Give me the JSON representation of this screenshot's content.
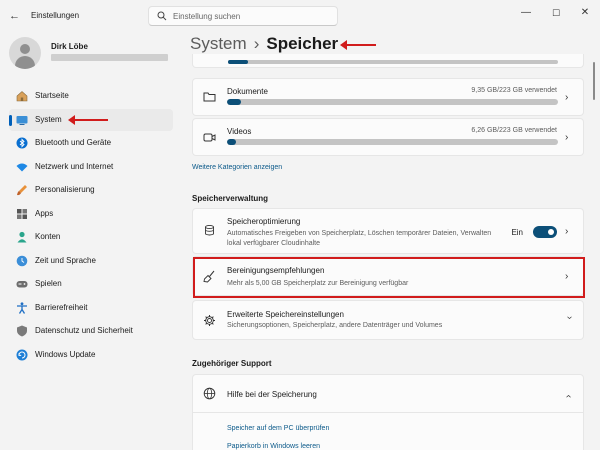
{
  "window": {
    "app_title": "Einstellungen",
    "controls": {
      "minimize": "—",
      "maximize": "☐",
      "close": "✕"
    }
  },
  "search": {
    "placeholder": "Einstellung suchen"
  },
  "profile": {
    "name": "Dirk Löbe"
  },
  "sidebar": {
    "items": [
      {
        "label": "Startseite",
        "icon": "home-icon"
      },
      {
        "label": "System",
        "icon": "system-display-icon",
        "active": true
      },
      {
        "label": "Bluetooth und Geräte",
        "icon": "bluetooth-icon"
      },
      {
        "label": "Netzwerk und Internet",
        "icon": "wifi-icon"
      },
      {
        "label": "Personalisierung",
        "icon": "paintbrush-icon"
      },
      {
        "label": "Apps",
        "icon": "apps-icon"
      },
      {
        "label": "Konten",
        "icon": "account-icon"
      },
      {
        "label": "Zeit und Sprache",
        "icon": "globe-clock-icon"
      },
      {
        "label": "Spielen",
        "icon": "gamepad-icon"
      },
      {
        "label": "Barrierefreiheit",
        "icon": "accessibility-icon"
      },
      {
        "label": "Datenschutz und Sicherheit",
        "icon": "shield-icon"
      },
      {
        "label": "Windows Update",
        "icon": "update-icon"
      }
    ]
  },
  "breadcrumb": {
    "parent": "System",
    "separator": "›",
    "current": "Speicher"
  },
  "categories": [
    {
      "title": "Dokumente",
      "usage": "9,35 GB/223 GB verwendet",
      "fraction": 0.042,
      "icon": "folder-icon"
    },
    {
      "title": "Videos",
      "usage": "6,26 GB/223 GB verwendet",
      "fraction": 0.028,
      "icon": "video-icon"
    }
  ],
  "more_categories_link": "Weitere Kategorien anzeigen",
  "speicherverwaltung": {
    "heading": "Speicherverwaltung",
    "speicheroptimierung": {
      "title": "Speicheroptimierung",
      "description": "Automatisches Freigeben von Speicherplatz, Löschen temporärer Dateien, Verwalten lokal verfügbarer Cloudinhalte",
      "toggle_label": "Ein",
      "toggle_on": true
    },
    "bereinigung": {
      "title": "Bereinigungsempfehlungen",
      "description": "Mehr als 5,00 GB Speicherplatz zur Bereinigung verfügbar"
    },
    "erweitert": {
      "title": "Erweiterte Speichereinstellungen",
      "description": "Sicherungsoptionen, Speicherplatz, andere Datenträger und Volumes"
    }
  },
  "support": {
    "heading": "Zugehöriger Support",
    "hilfe_title": "Hilfe bei der Speicherung",
    "links": [
      "Speicher auf dem PC überprüfen",
      "Papierkorb in Windows leeren"
    ]
  },
  "colors": {
    "accent": "#0c4f78",
    "annotation_red": "#d11c1c",
    "link": "#0c5a8a"
  }
}
